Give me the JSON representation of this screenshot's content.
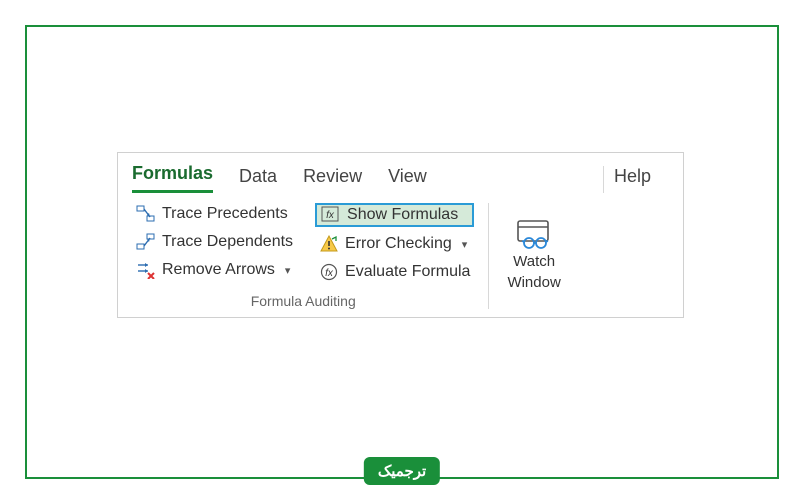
{
  "tabs": {
    "formulas": "Formulas",
    "data": "Data",
    "review": "Review",
    "view": "View",
    "help": "Help"
  },
  "commands": {
    "trace_precedents": "Trace Precedents",
    "trace_dependents": "Trace Dependents",
    "remove_arrows": "Remove Arrows",
    "show_formulas": "Show Formulas",
    "error_checking": "Error Checking",
    "evaluate_formula": "Evaluate Formula"
  },
  "watch": {
    "line1": "Watch",
    "line2": "Window"
  },
  "group_label": "Formula Auditing",
  "badge": "ترجمیک"
}
